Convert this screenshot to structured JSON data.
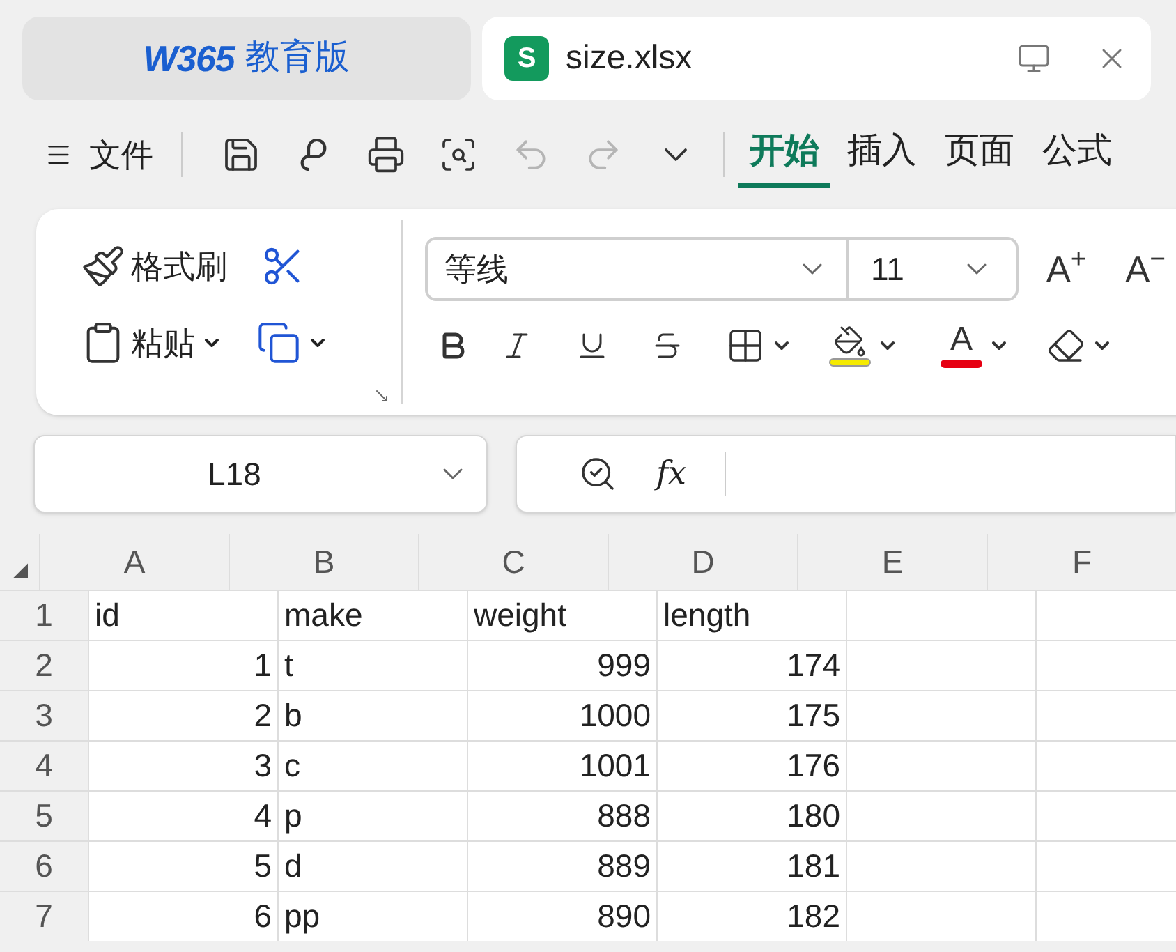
{
  "app_tab": {
    "brand": "W365",
    "edition": "教育版",
    "selected": false
  },
  "doc_tab": {
    "icon_letter": "S",
    "title": "size.xlsx",
    "selected": true
  },
  "toolbar": {
    "file_menu": "文件",
    "quick_access": [
      {
        "kind": "save",
        "disabled": false
      },
      {
        "kind": "brush",
        "disabled": false
      },
      {
        "kind": "print",
        "disabled": false
      },
      {
        "kind": "preview",
        "disabled": false
      },
      {
        "kind": "undo",
        "disabled": true
      },
      {
        "kind": "redo",
        "disabled": true
      },
      {
        "kind": "more",
        "disabled": false
      }
    ],
    "tabs": [
      {
        "label": "开始",
        "selected": true
      },
      {
        "label": "插入",
        "selected": false
      },
      {
        "label": "页面",
        "selected": false
      },
      {
        "label": "公式",
        "selected": false
      }
    ]
  },
  "ribbon": {
    "format_painter": "格式刷",
    "paste": "粘贴",
    "font_name": "等线",
    "font_size": "11",
    "grow_font": "A$^{+}$",
    "shrink_font": "A$^{−}$",
    "font_color": {
      "glyph": "A"
    }
  },
  "formula_bar": {
    "name_box": "L18",
    "fx": "fx"
  },
  "sheet": {
    "columns": [
      "A",
      "B",
      "C",
      "D",
      "E",
      "F"
    ],
    "rows": [
      {
        "header": "1",
        "cells": [
          {
            "text": "id",
            "kind": "text"
          },
          {
            "text": "make",
            "kind": "text"
          },
          {
            "text": "weight",
            "kind": "text"
          },
          {
            "text": "length",
            "kind": "text"
          }
        ]
      },
      {
        "header": "2",
        "cells": [
          {
            "text": "1",
            "kind": "number"
          },
          {
            "text": "t",
            "kind": "text"
          },
          {
            "text": "999",
            "kind": "number"
          },
          {
            "text": "174",
            "kind": "number"
          }
        ]
      },
      {
        "header": "3",
        "cells": [
          {
            "text": "2",
            "kind": "number"
          },
          {
            "text": "b",
            "kind": "text"
          },
          {
            "text": "1000",
            "kind": "number"
          },
          {
            "text": "175",
            "kind": "number"
          }
        ]
      },
      {
        "header": "4",
        "cells": [
          {
            "text": "3",
            "kind": "number"
          },
          {
            "text": "c",
            "kind": "text"
          },
          {
            "text": "1001",
            "kind": "number"
          },
          {
            "text": "176",
            "kind": "number"
          }
        ]
      },
      {
        "header": "5",
        "cells": [
          {
            "text": "4",
            "kind": "number"
          },
          {
            "text": "p",
            "kind": "text"
          },
          {
            "text": "888",
            "kind": "number"
          },
          {
            "text": "180",
            "kind": "number"
          }
        ]
      },
      {
        "header": "6",
        "cells": [
          {
            "text": "5",
            "kind": "number"
          },
          {
            "text": "d",
            "kind": "text"
          },
          {
            "text": "889",
            "kind": "number"
          },
          {
            "text": "181",
            "kind": "number"
          }
        ]
      },
      {
        "header": "7",
        "cells": [
          {
            "text": "6",
            "kind": "number"
          },
          {
            "text": "pp",
            "kind": "text"
          },
          {
            "text": "890",
            "kind": "number"
          },
          {
            "text": "182",
            "kind": "number"
          }
        ]
      }
    ]
  }
}
